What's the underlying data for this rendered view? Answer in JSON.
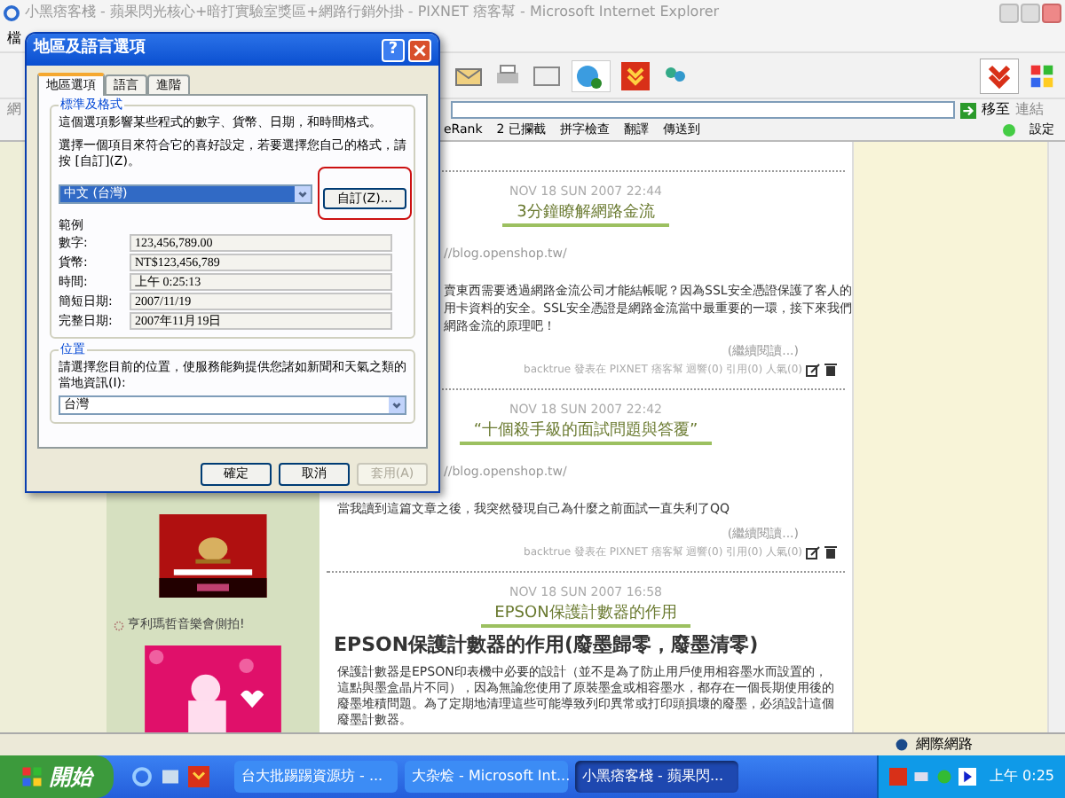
{
  "window": {
    "title": "小黑痞客棧 - 蘋果閃光核心+暗打實驗室獎區+網路行銷外掛 - PIXNET 痞客幫 - Microsoft Internet Explorer"
  },
  "menu": [
    "檔"
  ],
  "address": {
    "label": "網",
    "go": "移至",
    "links": "連結"
  },
  "google_toolbar": {
    "items": [
      "eRank",
      "2 已攔截",
      "拼字檢查",
      "翻譯",
      "傳送到"
    ],
    "settings": "設定"
  },
  "sidebar": {
    "item": "亨利瑪哲音樂會側拍!"
  },
  "posts": [
    {
      "date": "NOV 18 SUN 2007 22:44",
      "title": "3分鐘瞭解網路金流",
      "link": "//blog.openshop.tw/",
      "lines": [
        "賣東西需要透過網路金流公司才能結帳呢？因為SSL安全憑證保護了客人的",
        "用卡資料的安全。SSL安全憑證是網路金流當中最重要的一環，接下來我們",
        "網路金流的原理吧！"
      ],
      "more": "(繼續閱讀...)",
      "footer": "backtrue 發表在 PIXNET 痞客幫 迴響(0) 引用(0) 人氣(0)"
    },
    {
      "date": "NOV 18 SUN 2007 22:42",
      "title": "“十個殺手級的面試問題與答覆”",
      "link": "//blog.openshop.tw/",
      "lines": [
        "當我讀到這篇文章之後，我突然發現自己為什麼之前面試一直失利了QQ"
      ],
      "more": "(繼續閱讀...)",
      "footer": "backtrue 發表在 PIXNET 痞客幫 迴響(0) 引用(0) 人氣(0)"
    },
    {
      "date": "NOV 18 SUN 2007 16:58",
      "title": "EPSON保護計數器的作用",
      "heading": "EPSON保護計數器的作用(廢墨歸零，廢墨清零)",
      "lines": [
        "保護計數器是EPSON印表機中必要的設計（並不是為了防止用戶使用相容墨水而設置的，",
        "這點與墨盒晶片不同），因為無論您使用了原裝墨盒或相容墨水，都存在一個長期使用後的",
        "廢墨堆積問題。為了定期地清理這些可能導致列印異常或打印頭損壞的廢墨，必須設計這個",
        "廢墨計數器。"
      ]
    }
  ],
  "dialog": {
    "title": "地區及語言選項",
    "help": "?",
    "tabs": [
      {
        "label": "地區選項",
        "selected": true
      },
      {
        "label": "語言",
        "selected": false
      },
      {
        "label": "進階",
        "selected": false
      }
    ],
    "formats": {
      "legend": "標準及格式",
      "description": "這個選項影響某些程式的數字、貨幣、日期，和時間格式。",
      "instruction": "選擇一個項目來符合它的喜好設定，若要選擇您自己的格式，請按 [自訂](Z)。",
      "selection": "中文 (台灣)",
      "customize": "自訂(Z)...",
      "highlighted": true,
      "samples_label": "範例",
      "samples": [
        {
          "label": "數字:",
          "value": "123,456,789.00"
        },
        {
          "label": "貨幣:",
          "value": "NT$123,456,789"
        },
        {
          "label": "時間:",
          "value": "上午 0:25:13"
        },
        {
          "label": "簡短日期:",
          "value": "2007/11/19"
        },
        {
          "label": "完整日期:",
          "value": "2007年11月19日"
        }
      ]
    },
    "location": {
      "legend": "位置",
      "description": "請選擇您目前的位置，使服務能夠提供您諸如新聞和天氣之類的當地資訊(I):",
      "selection": "台灣"
    },
    "buttons": [
      {
        "label": "確定",
        "disabled": false
      },
      {
        "label": "取消",
        "disabled": false
      },
      {
        "label": "套用(A)",
        "disabled": true
      }
    ]
  },
  "status_bar": {
    "zone": "網際網路"
  },
  "taskbar": {
    "start": "開始",
    "tasks": [
      {
        "label": "台大批踢踢資源坊 - ...",
        "selected": false
      },
      {
        "label": "大杂烩 - Microsoft Int...",
        "selected": false
      },
      {
        "label": "小黑痞客棧 - 蘋果閃...",
        "selected": true
      }
    ],
    "clock": "上午 0:25"
  }
}
